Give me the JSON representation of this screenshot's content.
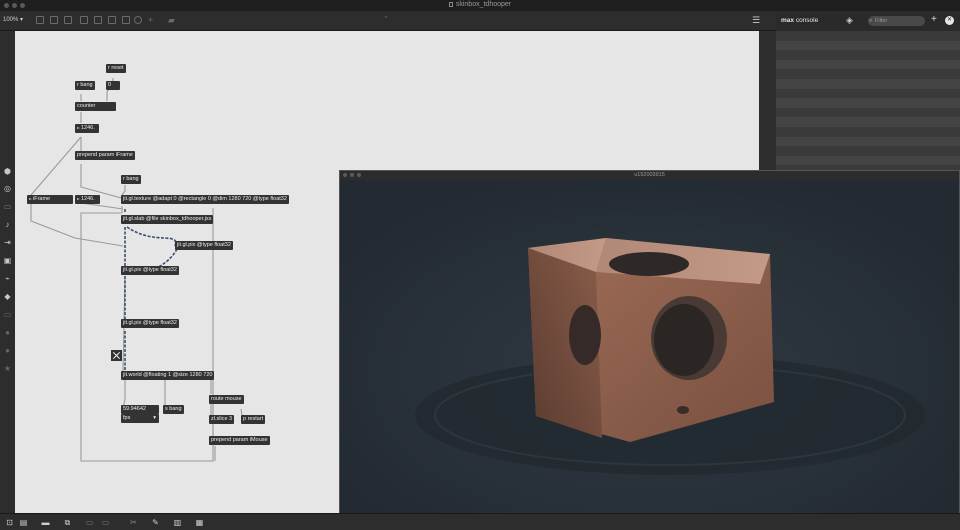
{
  "window": {
    "title": "skinbox_tdhooper"
  },
  "toolbar": {
    "zoom": "100%",
    "zoom_arrow": "▾"
  },
  "patcher": {
    "objects": {
      "r_reset": "r reset",
      "msg_zero": "0",
      "r_bang_top": "r bang",
      "counter": "counter",
      "num_1246": "1246.",
      "prepend_iframe": "prepend param iFrame",
      "r_bang_mid": "r bang",
      "iframe_label": "iFrame",
      "num_1246_b": "1246.",
      "jit_gl_texture": "jit.gl.texture @adapt 0 @rectangle 0 @dim 1280 720 @type float32",
      "jit_gl_slab": "jit.gl.slab @file skinbox_tdhooper.jxs",
      "jit_gl_pix_right": "jit.gl.pix @type float32",
      "jit_gl_pix_left": "jit.gl.pix @type float32",
      "jit_gl_pix_lower": "jit.gl.pix @type float32",
      "jit_world": "jit.world @floating 1 @size 1280 720",
      "fps_value": "59.94642",
      "fps_unit": "fps",
      "s_bang": "s bang",
      "route_mouse": "route mouse",
      "zl_slice": "zl.slice 3",
      "p_restart": "p restart",
      "prepend_imouse": "prepend param iMouse"
    }
  },
  "console": {
    "title_bold": "max",
    "title_rest": "console",
    "filter_placeholder": "Filter",
    "add_glyph": "+",
    "clear_glyph": "✕"
  },
  "jitter_window": {
    "title": "u152003915"
  },
  "colors": {
    "canvas": "#e6e6e6",
    "object": "#333333",
    "chrome": "#2d2d2d",
    "render_bg": "#283037",
    "cube": "#9a6a55"
  }
}
